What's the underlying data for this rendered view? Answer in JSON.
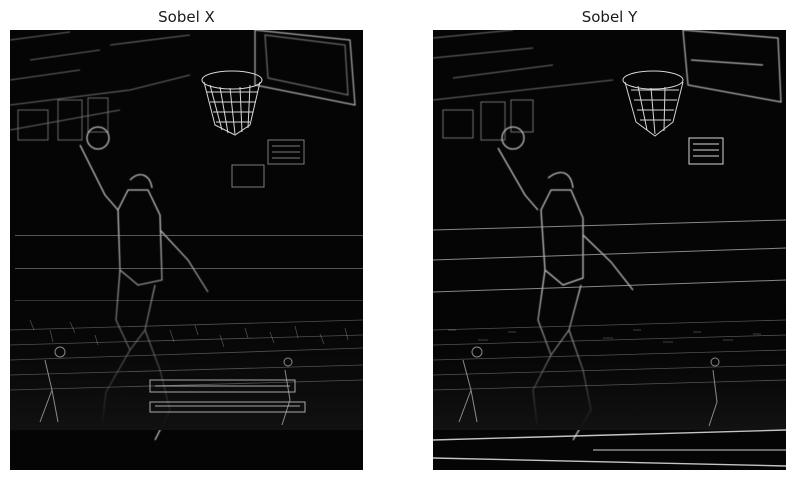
{
  "figure": {
    "panels": [
      {
        "title": "Sobel X",
        "image_label": "sobel-x-edge-map"
      },
      {
        "title": "Sobel Y",
        "image_label": "sobel-y-edge-map"
      }
    ]
  }
}
